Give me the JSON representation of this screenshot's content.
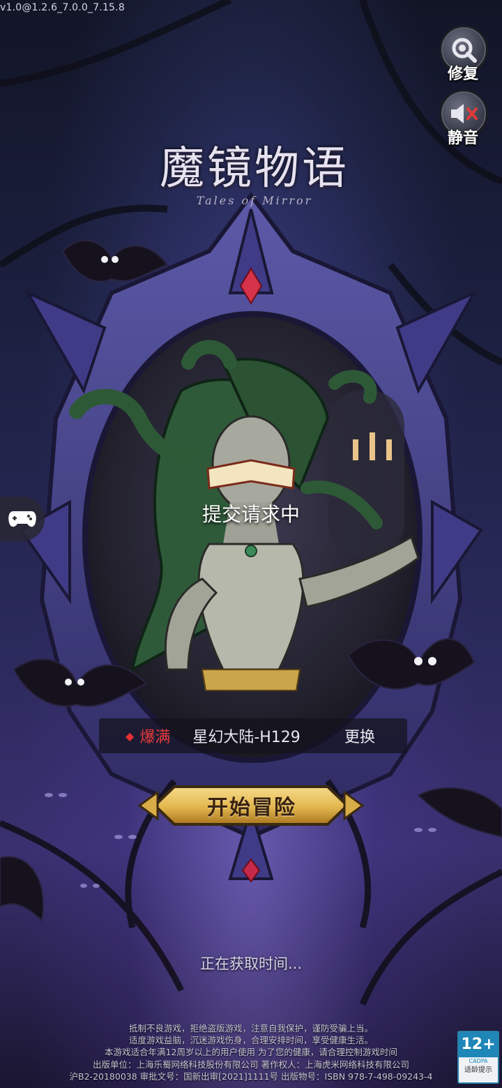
{
  "version": "v1.0@1.2.6_7.0.0_7.15.8",
  "side_buttons": {
    "repair_label": "修复",
    "mute_label": "静音"
  },
  "logo": {
    "title": "魔镜物语",
    "subtitle": "Tales of Mirror"
  },
  "loading_text": "提交请求中",
  "server": {
    "status": "爆满",
    "name": "星幻大陆-H129",
    "change_label": "更换"
  },
  "start_button": "开始冒险",
  "time_status": "正在获取时间...",
  "notice": {
    "line1": "抵制不良游戏，拒绝盗版游戏，注意自我保护，谨防受骗上当。",
    "line2": "适度游戏益脑，沉迷游戏伤身，合理安排时间，享受健康生活。",
    "line3": "本游戏适合年满12周岁以上的用户使用 为了您的健康，请合理控制游戏时间",
    "line4": "出版单位：上海乐蜀网络科技股份有限公司 著作权人：上海虎米网络科技有限公司",
    "line5": "沪B2-20180038 审批文号：国新出审[2021]1111号 出版物号：ISBN 978-7-498-09243-4"
  },
  "age_rating": {
    "age": "12+",
    "org": "CADPA",
    "hint": "适龄提示"
  },
  "colors": {
    "status_red": "#e83a3a",
    "button_gold": "#e9c565",
    "mirror_frame": "#4a3f8a"
  }
}
